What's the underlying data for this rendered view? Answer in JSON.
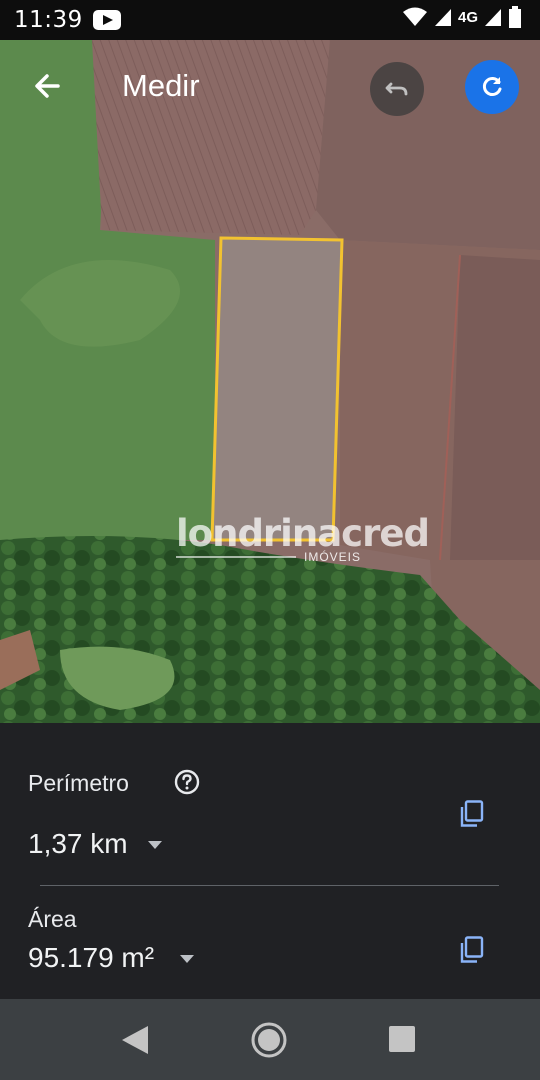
{
  "status_bar": {
    "time": "11:39",
    "network": "4G",
    "icons": [
      "youtube-icon",
      "wifi-icon",
      "signal-icon",
      "battery-icon"
    ]
  },
  "header": {
    "title": "Medir",
    "back_icon": "arrow-left-icon",
    "undo_icon": "undo-icon",
    "redo_icon": "refresh-icon"
  },
  "map": {
    "watermark": {
      "brand": "londrinacred",
      "tag": "IMÓVEIS"
    },
    "measure_color": "#f2c230"
  },
  "measurement": {
    "perimeter_label": "Perímetro",
    "perimeter_value": "1,37 km",
    "area_label": "Área",
    "area_value": "95.179 m²",
    "help_icon": "help-circle-icon",
    "copy_icon": "copy-icon"
  },
  "colors": {
    "accent": "#1a73e8",
    "sheet_bg": "#202124",
    "nav_bg": "#3c4043"
  }
}
